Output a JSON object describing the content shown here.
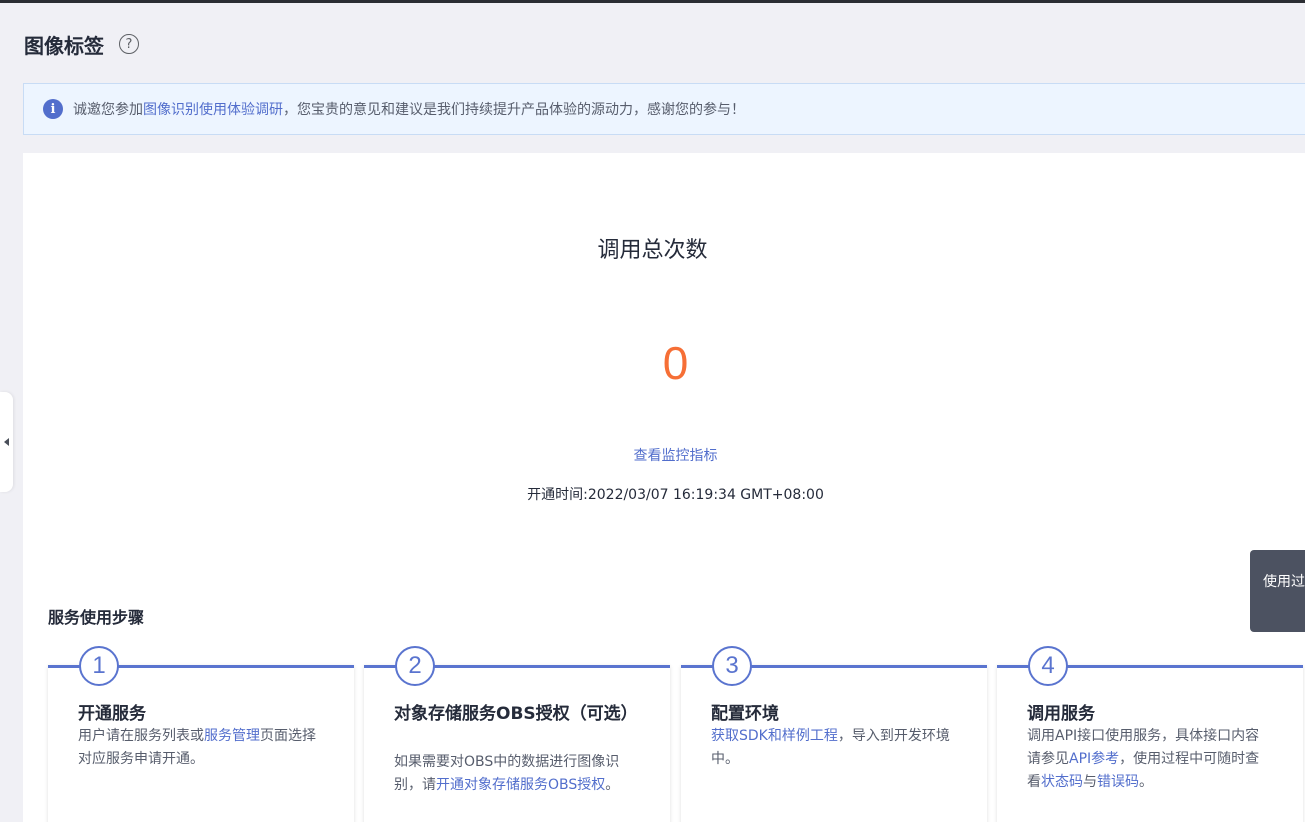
{
  "header": {
    "title": "图像标签",
    "help_icon": "question-circle-icon"
  },
  "notice": {
    "icon": "info-circle-icon",
    "text_before": "诚邀您参加",
    "link": "图像识别使用体验调研",
    "text_after": "，您宝贵的意见和建议是我们持续提升产品体验的源动力，感谢您的参与！"
  },
  "stats": {
    "title": "调用总次数",
    "value": "0",
    "monitor_link": "查看监控指标",
    "open_time": "开通时间:2022/03/07 16:19:34 GMT+08:00"
  },
  "floating_tip": {
    "label": "使用过"
  },
  "steps": {
    "title": "服务使用步骤",
    "items": [
      {
        "num": "1",
        "title": "开通服务",
        "desc_before": "用户请在服务列表或",
        "link": "服务管理",
        "desc_after": "页面选择对应服务申请开通。"
      },
      {
        "num": "2",
        "title": "对象存储服务OBS授权（可选）",
        "desc_before": "如果需要对OBS中的数据进行图像识别，请",
        "link": "开通对象存储服务OBS授权",
        "desc_after": "。"
      },
      {
        "num": "3",
        "title": "配置环境",
        "desc_before": "",
        "link": "获取SDK和样例工程",
        "desc_after": "，导入到开发环境中。"
      },
      {
        "num": "4",
        "title": "调用服务",
        "desc_before": "调用API接口使用服务，具体接口内容请参见",
        "link": "API参考",
        "desc_mid": "，使用过程中可随时查看",
        "link2": "状态码",
        "desc_mid2": "与",
        "link3": "错误码",
        "desc_after": "。"
      }
    ]
  },
  "colors": {
    "accent": "#526ecc",
    "count": "#f66f36",
    "step_line": "#5a74cf"
  }
}
